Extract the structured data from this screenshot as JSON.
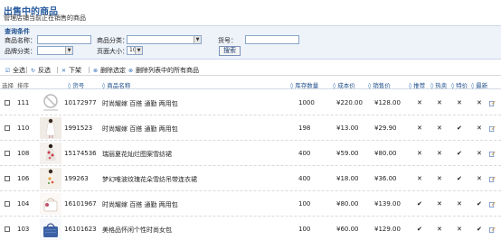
{
  "header": {
    "title": "出售中的商品",
    "subtitle": "管理店铺当前正在销售的商品"
  },
  "query": {
    "title": "查询条件",
    "name_label": "商品名称：",
    "category_label": "商品分类：",
    "code_label": "货号：",
    "brand_label": "品牌分类：",
    "pagesize_label": "页面大小：",
    "pagesize_value": "10",
    "search_label": "搜索"
  },
  "toolbar": {
    "select_all": "全选",
    "invert": "反选",
    "unshelve": "下架",
    "delete_selected": "删除选定",
    "delete_all": "删除列表中的所有商品"
  },
  "table": {
    "headers": {
      "select": "选择",
      "order": "排序",
      "code": "货号",
      "name": "商品名称",
      "stock": "库存数量",
      "cost": "成本价",
      "price": "销售价",
      "recommend": "推荐",
      "hot": "热卖",
      "special": "特价",
      "new": "最新"
    },
    "rows": [
      {
        "order": "111",
        "code": "10172977",
        "name": "时尚耀嫁 百搭 通勤 两用包",
        "stock": "1000",
        "cost": "¥220.00",
        "price": "¥128.00",
        "thumb": "placeholder",
        "flags": [
          "x",
          "x",
          "x",
          "x"
        ]
      },
      {
        "order": "110",
        "code": "1991523",
        "name": "时尚耀嫁 百搭 通勤 两用包",
        "stock": "198",
        "cost": "¥13.00",
        "price": "¥29.90",
        "thumb": "white-dress",
        "flags": [
          "x",
          "x",
          "check",
          "x"
        ]
      },
      {
        "order": "108",
        "code": "15174536",
        "name": "瑞丽夏花灿烂图案雪纺裙",
        "stock": "400",
        "cost": "¥59.00",
        "price": "¥80.00",
        "thumb": "red-dress",
        "flags": [
          "x",
          "x",
          "check",
          "x"
        ]
      },
      {
        "order": "106",
        "code": "199263",
        "name": "梦幻唯波纹瑰花朵雪纺吊带连衣裙",
        "stock": "400",
        "cost": "¥18.00",
        "price": "¥36.00",
        "thumb": "floral-dress",
        "flags": [
          "x",
          "x",
          "check",
          "x"
        ]
      },
      {
        "order": "104",
        "code": "16101967",
        "name": "时尚耀嫁 百搭 通勤 两用包",
        "stock": "100",
        "cost": "¥80.00",
        "price": "¥139.00",
        "thumb": "white-bag",
        "flags": [
          "check",
          "x",
          "x",
          "check"
        ]
      },
      {
        "order": "103",
        "code": "16101623",
        "name": "美格品怀闲个性时尚女包",
        "stock": "100",
        "cost": "¥60.00",
        "price": "¥129.00",
        "thumb": "blue-bag",
        "flags": [
          "check",
          "x",
          "x",
          "check"
        ]
      }
    ]
  },
  "colors": {
    "title": "#2a5d9f",
    "header_text": "#1e4e8c",
    "query_bg": "#eef3fa"
  }
}
